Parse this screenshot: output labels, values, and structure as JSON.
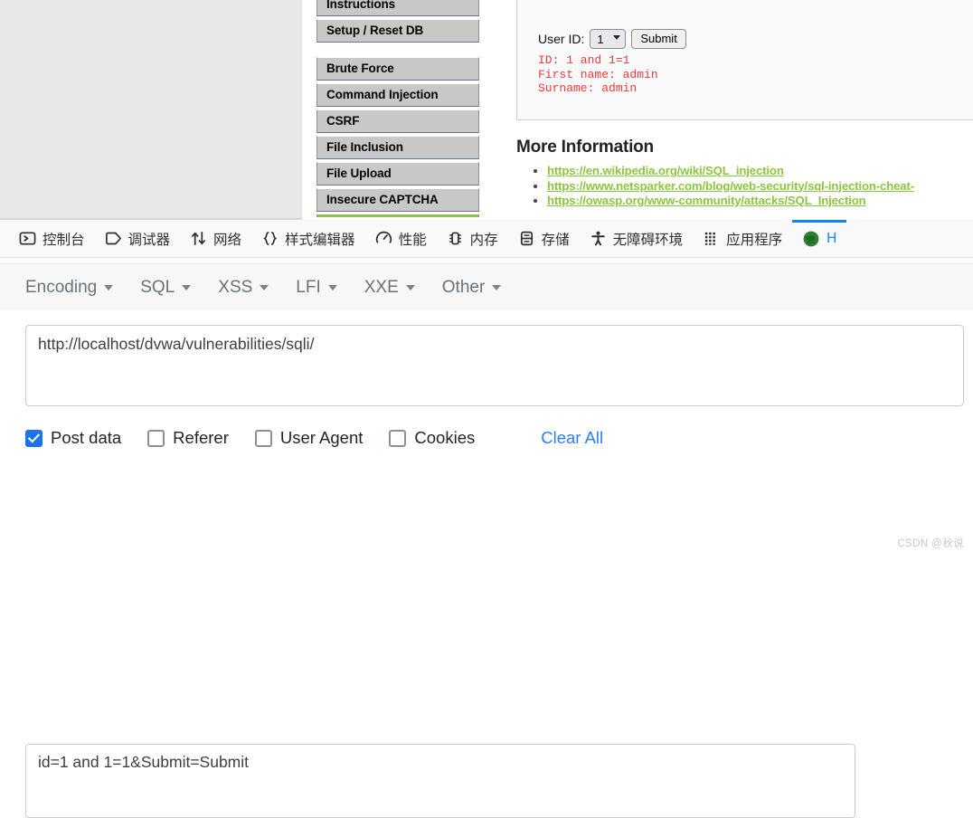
{
  "browser_page": {
    "sidebar": {
      "top_items": [
        {
          "label": "Instructions"
        },
        {
          "label": "Setup / Reset DB"
        }
      ],
      "vuln_items": [
        {
          "label": "Brute Force"
        },
        {
          "label": "Command Injection"
        },
        {
          "label": "CSRF"
        },
        {
          "label": "File Inclusion"
        },
        {
          "label": "File Upload"
        },
        {
          "label": "Insecure CAPTCHA"
        }
      ],
      "active_accent_color": "#8bc34a"
    },
    "vuln_panel": {
      "user_id_label": "User ID:",
      "user_id_value": "1",
      "user_id_options": [
        "1"
      ],
      "submit_label": "Submit",
      "result_text": "ID: 1 and 1=1\nFirst name: admin\nSurname: admin",
      "result_color": "#ee3b3b"
    },
    "more_information": {
      "title": "More Information",
      "link_color": "#8cc63e",
      "links": [
        "https://en.wikipedia.org/wiki/SQL_injection",
        "https://www.netsparker.com/blog/web-security/sql-injection-cheat-",
        "https://owasp.org/www-community/attacks/SQL_Injection"
      ]
    }
  },
  "devtools": {
    "active_tab_color": "#0a84ff",
    "tabs": [
      {
        "label": "控制台",
        "icon": "console-icon",
        "active": false
      },
      {
        "label": "调试器",
        "icon": "debugger-icon",
        "active": false
      },
      {
        "label": "网络",
        "icon": "network-icon",
        "active": false
      },
      {
        "label": "样式编辑器",
        "icon": "style-editor-icon",
        "active": false
      },
      {
        "label": "性能",
        "icon": "performance-icon",
        "active": false
      },
      {
        "label": "内存",
        "icon": "memory-icon",
        "active": false
      },
      {
        "label": "存储",
        "icon": "storage-icon",
        "active": false
      },
      {
        "label": "无障碍环境",
        "icon": "accessibility-icon",
        "active": false
      },
      {
        "label": "应用程序",
        "icon": "application-icon",
        "active": false
      },
      {
        "label": "H",
        "icon": "hackbar-icon",
        "active": true
      }
    ]
  },
  "hackbar": {
    "menu": [
      {
        "label": "Encoding"
      },
      {
        "label": "SQL"
      },
      {
        "label": "XSS"
      },
      {
        "label": "LFI"
      },
      {
        "label": "XXE"
      },
      {
        "label": "Other"
      }
    ],
    "url_value": "http://localhost/dvwa/vulnerabilities/sqli/",
    "options": [
      {
        "label": "Post data",
        "checked": true
      },
      {
        "label": "Referer",
        "checked": false
      },
      {
        "label": "User Agent",
        "checked": false
      },
      {
        "label": "Cookies",
        "checked": false
      }
    ],
    "clear_all_label": "Clear All",
    "post_data_value": "id=1 and 1=1&Submit=Submit"
  },
  "watermark": "CSDN @秋说"
}
